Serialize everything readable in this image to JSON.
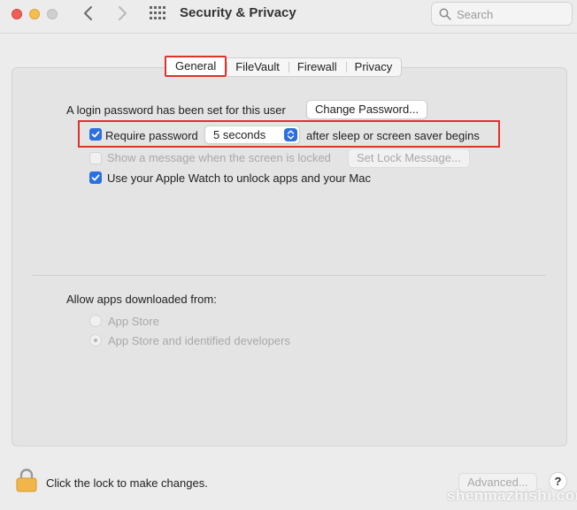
{
  "window": {
    "title": "Security & Privacy",
    "search_placeholder": "Search"
  },
  "tabs": [
    {
      "label": "General",
      "active": true
    },
    {
      "label": "FileVault",
      "active": false
    },
    {
      "label": "Firewall",
      "active": false
    },
    {
      "label": "Privacy",
      "active": false
    }
  ],
  "general": {
    "login_password_text": "A login password has been set for this user",
    "change_password_button": "Change Password...",
    "require_password_label": "Require password",
    "require_password_checked": true,
    "require_password_delay": "5 seconds",
    "require_password_suffix": "after sleep or screen saver begins",
    "show_message_label": "Show a message when the screen is locked",
    "show_message_checked": false,
    "set_lock_message_button": "Set Lock Message...",
    "apple_watch_label": "Use your Apple Watch to unlock apps and your Mac",
    "apple_watch_checked": true
  },
  "allow_apps": {
    "heading": "Allow apps downloaded from:",
    "options": [
      {
        "label": "App Store",
        "selected": false
      },
      {
        "label": "App Store and identified developers",
        "selected": true
      }
    ]
  },
  "footer": {
    "lock_text": "Click the lock to make changes.",
    "advanced_button": "Advanced...",
    "help_label": "?"
  },
  "watermark": "shenmazhishi.com",
  "colors": {
    "accent_blue": "#2b6fe0",
    "highlight_red": "#e0322b"
  }
}
